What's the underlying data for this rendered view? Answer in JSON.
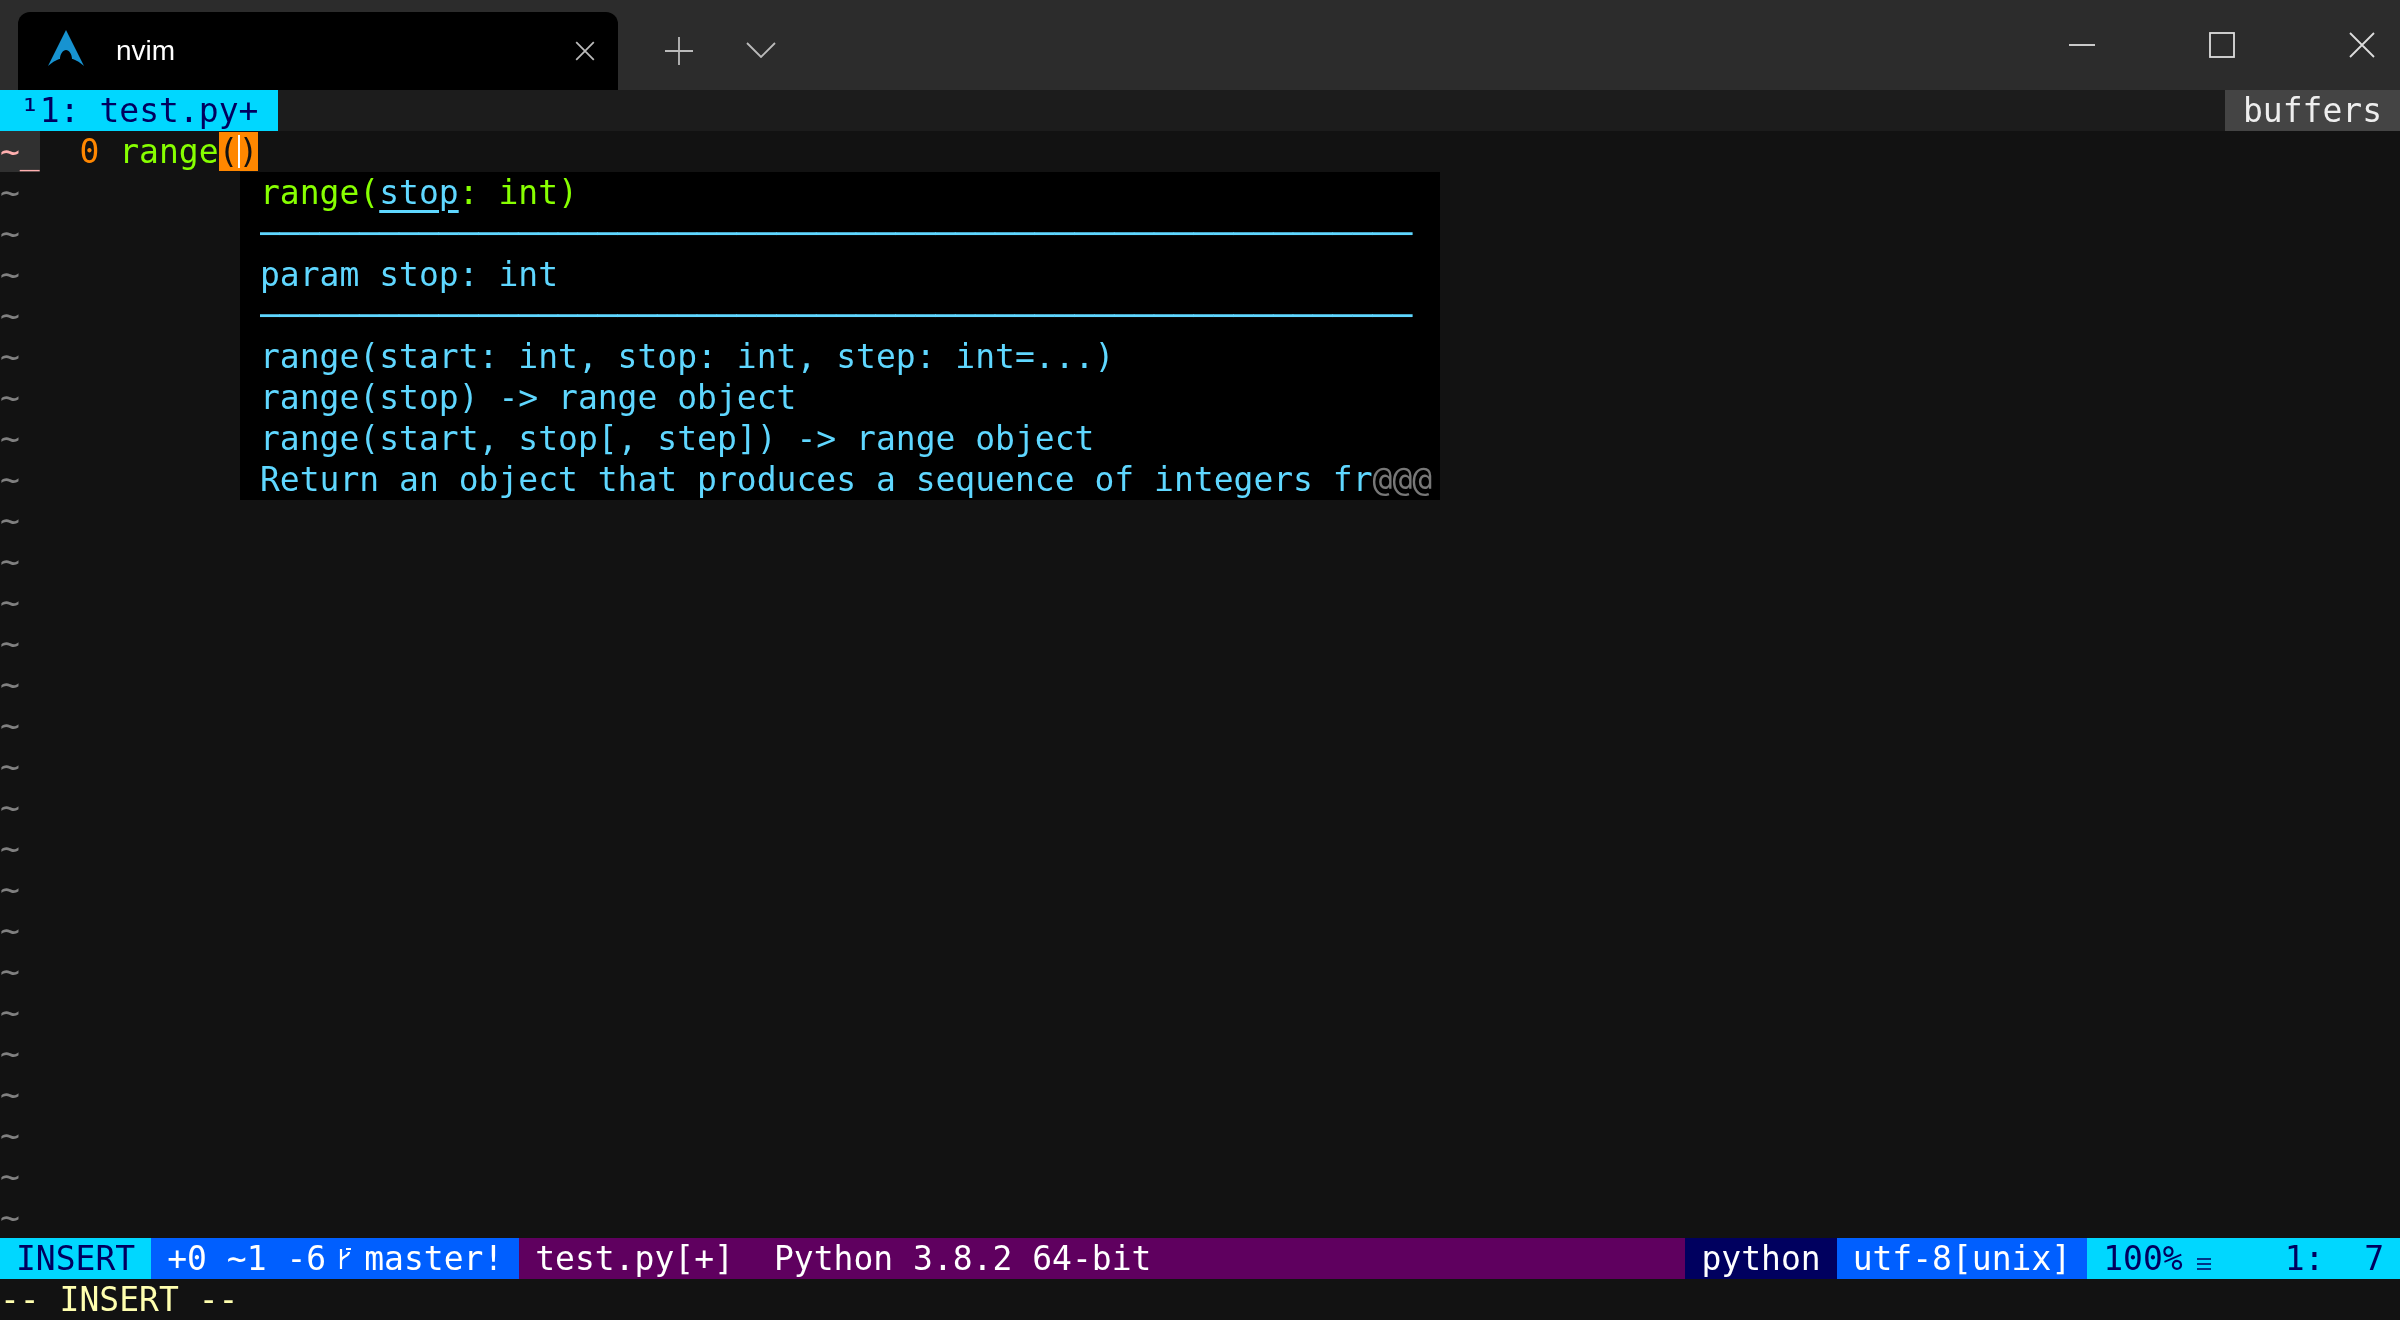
{
  "window": {
    "tab_title": "nvim"
  },
  "tabline": {
    "tabs": [
      {
        "label": "¹1: test.py+",
        "selected": true
      }
    ],
    "right_label": "buffers"
  },
  "editor": {
    "lines": [
      {
        "kind": "code",
        "sign": "~_",
        "number": "0",
        "tokens": [
          {
            "kind": "function",
            "text": "range",
            "cursor": false
          },
          {
            "kind": "bracket",
            "text": "(",
            "cursor": false
          },
          {
            "kind": "bracket",
            "text": ")",
            "cursor": true
          }
        ]
      },
      {
        "kind": "filler",
        "text": "~"
      },
      {
        "kind": "filler",
        "text": "~"
      },
      {
        "kind": "filler",
        "text": "~"
      },
      {
        "kind": "filler",
        "text": "~"
      },
      {
        "kind": "filler",
        "text": "~"
      },
      {
        "kind": "filler",
        "text": "~"
      },
      {
        "kind": "filler",
        "text": "~"
      },
      {
        "kind": "filler",
        "text": "~"
      },
      {
        "kind": "filler",
        "text": "~"
      },
      {
        "kind": "filler",
        "text": "~"
      },
      {
        "kind": "filler",
        "text": "~"
      },
      {
        "kind": "filler",
        "text": "~"
      },
      {
        "kind": "filler",
        "text": "~"
      },
      {
        "kind": "filler",
        "text": "~"
      },
      {
        "kind": "filler",
        "text": "~"
      },
      {
        "kind": "filler",
        "text": "~"
      },
      {
        "kind": "filler",
        "text": "~"
      },
      {
        "kind": "filler",
        "text": "~"
      },
      {
        "kind": "filler",
        "text": "~"
      },
      {
        "kind": "filler",
        "text": "~"
      },
      {
        "kind": "filler",
        "text": "~"
      },
      {
        "kind": "filler",
        "text": "~"
      },
      {
        "kind": "filler",
        "text": "~"
      },
      {
        "kind": "filler",
        "text": "~"
      },
      {
        "kind": "filler",
        "text": "~"
      },
      {
        "kind": "filler",
        "text": "~"
      }
    ]
  },
  "popup": {
    "lines": [
      {
        "kind": "signature",
        "parts": [
          {
            "text": "range(",
            "active": false
          },
          {
            "text": "stop",
            "active": true
          },
          {
            "text": ": int)",
            "active": false
          }
        ]
      },
      {
        "kind": "rule",
        "text": "──────────────────────────────────────────────────────────"
      },
      {
        "kind": "doc",
        "text": "param stop: int"
      },
      {
        "kind": "rule",
        "text": "──────────────────────────────────────────────────────────"
      },
      {
        "kind": "doc",
        "text": "range(start: int, stop: int, step: int=...)"
      },
      {
        "kind": "doc",
        "text": "range(stop) -> range object"
      },
      {
        "kind": "doc",
        "text": "range(start, stop[, step]) -> range object"
      },
      {
        "kind": "doc",
        "text": "Return an object that produces a sequence of integers fr",
        "overflow": "@@@"
      }
    ]
  },
  "statusline": {
    "segments": [
      {
        "kind": "mode",
        "text": "INSERT",
        "color": "#00d7ff"
      },
      {
        "kind": "git",
        "diff": "+0 ~1 -6",
        "branch": "master!",
        "color": "#005fff"
      },
      {
        "kind": "file",
        "texts": [
          "test.py[+]",
          "Python 3.8.2 64-bit"
        ],
        "color": "#5f005f"
      },
      {
        "kind": "filetype",
        "text": "python",
        "color": "#00005f"
      },
      {
        "kind": "encoding",
        "text": "utf-8[unix]",
        "color": "#005fff"
      },
      {
        "kind": "position",
        "percent": "100%",
        "cursor": "1:  7",
        "color": "#00d7ff"
      }
    ]
  },
  "cmdline": {
    "text": "-- INSERT --"
  }
}
